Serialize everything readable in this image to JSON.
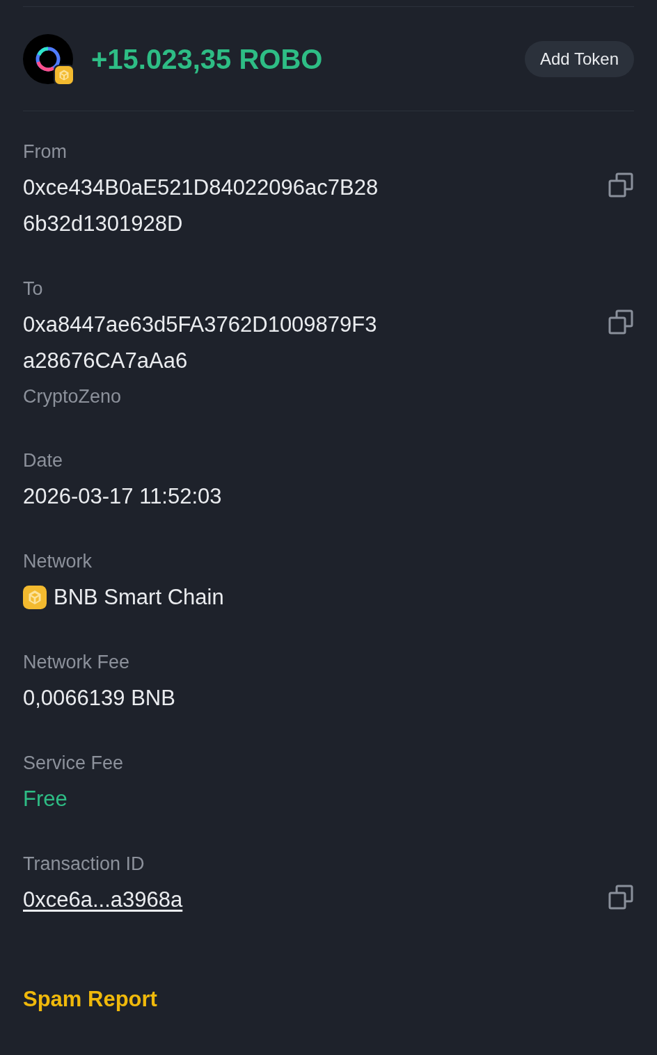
{
  "header": {
    "amount": "+15.023,35 ROBO",
    "button": "Add Token"
  },
  "fields": [
    {
      "kind": "address",
      "label": "From",
      "lines": [
        "0xce434B0aE521D84022096ac7B28",
        "6b32d1301928D"
      ],
      "copy": true
    },
    {
      "kind": "address",
      "label": "To",
      "lines": [
        "0xa8447ae63d5FA3762D1009879F3",
        "a28676CA7aAa6"
      ],
      "note": "CryptoZeno",
      "copy": true
    },
    {
      "kind": "text",
      "label": "Date",
      "lines": [
        "2026-03-17 11:52:03"
      ],
      "copy": false
    },
    {
      "kind": "network",
      "label": "Network",
      "lines": [
        "BNB Smart Chain"
      ],
      "copy": false
    },
    {
      "kind": "text",
      "label": "Network Fee",
      "lines": [
        "0,0066139 BNB"
      ],
      "copy": false
    },
    {
      "kind": "free",
      "label": "Service Fee",
      "lines": [
        "Free"
      ],
      "copy": false
    },
    {
      "kind": "link",
      "label": "Transaction ID",
      "lines": [
        "0xce6a...a3968a"
      ],
      "copy": true
    }
  ],
  "spam_report": "Spam Report"
}
